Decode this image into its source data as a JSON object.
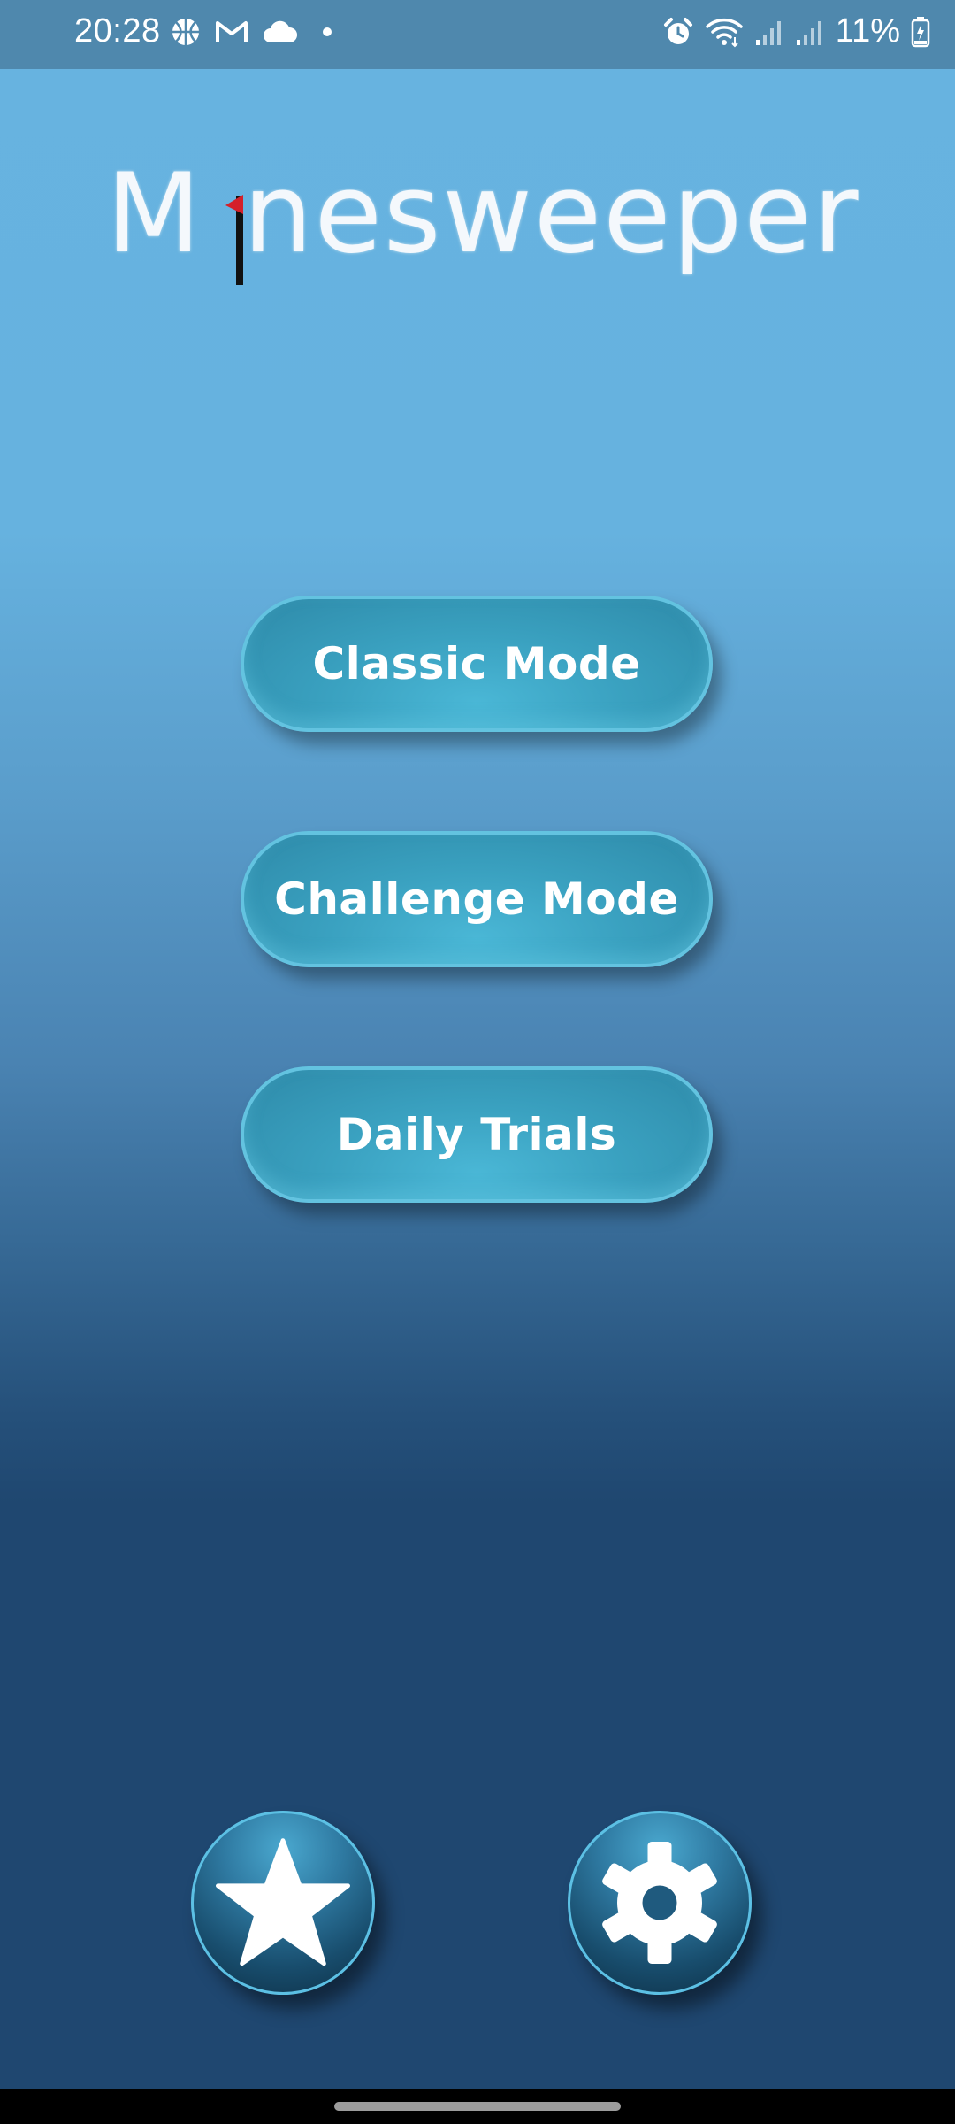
{
  "status_bar": {
    "time": "20:28",
    "battery": "11%",
    "left_icons": [
      "basketball-icon",
      "gmail-icon",
      "cloud-icon",
      "dot-icon"
    ],
    "right_icons": [
      "alarm-icon",
      "wifi-icon",
      "signal-icon",
      "signal-icon",
      "battery-charging-icon"
    ]
  },
  "app": {
    "logo_text_first": "M",
    "logo_text_rest": "nesweeper",
    "logo_flag_color": "#d4202a"
  },
  "menu": {
    "classic_label": "Classic Mode",
    "challenge_label": "Challenge Mode",
    "daily_label": "Daily Trials"
  },
  "bottom_buttons": {
    "left_icon": "star-icon",
    "right_icon": "gear-icon"
  },
  "colors": {
    "status_bar_bg": "#4f88ad",
    "background_top": "#67b3e0",
    "background_bottom": "#1f4770",
    "button_fill": "#3aa1c0",
    "button_border": "#63c3e0"
  }
}
